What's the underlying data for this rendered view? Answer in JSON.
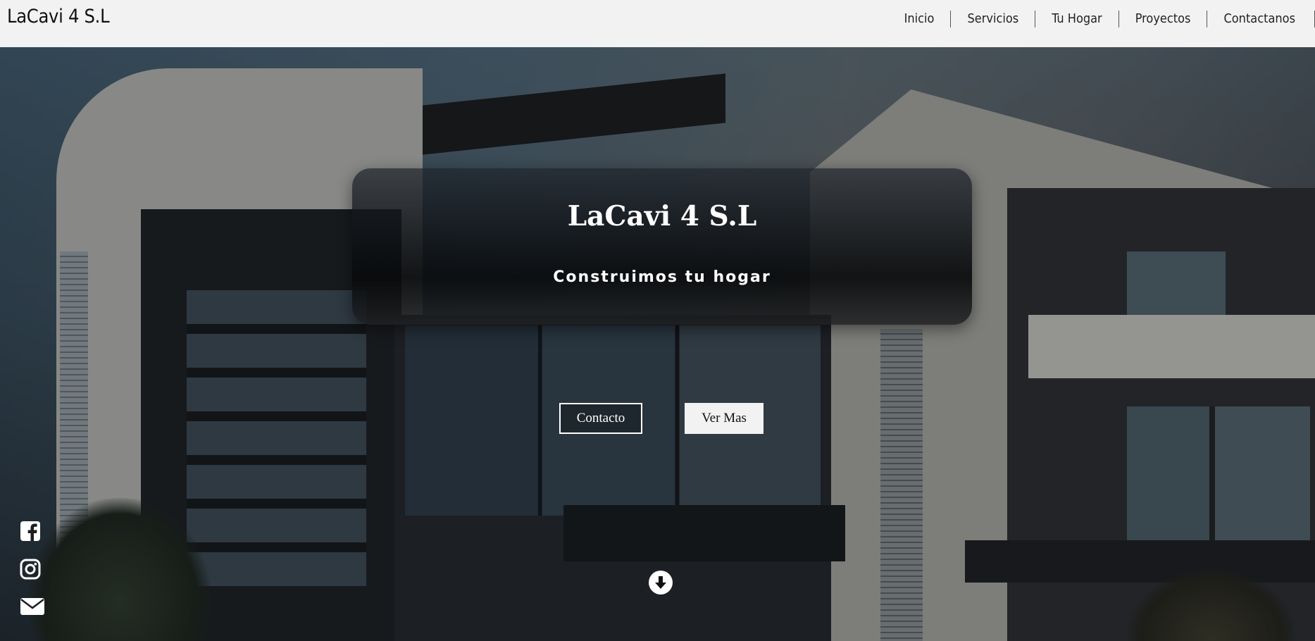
{
  "header": {
    "brand": "LaCavi 4 S.L",
    "nav": [
      "Inicio",
      "Servicios",
      "Tu Hogar",
      "Proyectos",
      "Contactanos"
    ]
  },
  "hero": {
    "title": "LaCavi 4 S.L",
    "subtitle": "Construimos tu hogar",
    "buttons": {
      "contact": "Contacto",
      "more": "Ver Mas"
    },
    "scroll_icon": "arrow-down-circle-icon"
  },
  "social": [
    "facebook-icon",
    "instagram-icon",
    "envelope-icon"
  ],
  "colors": {
    "header_bg": "#f2f2f2",
    "text_light": "#ffffff",
    "text_dark": "#111111"
  }
}
